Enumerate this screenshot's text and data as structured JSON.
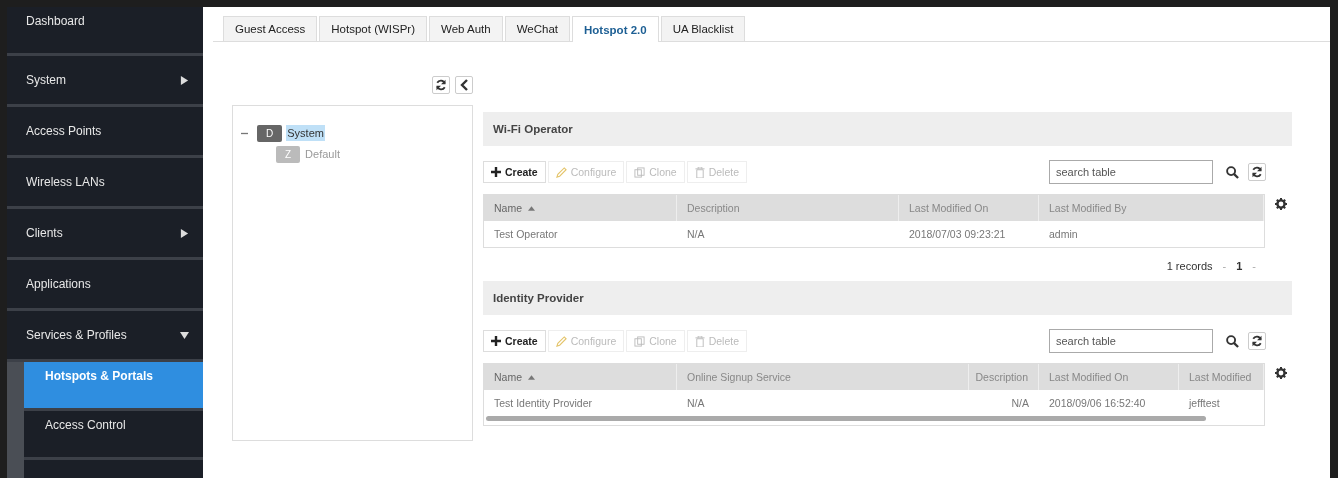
{
  "sidebar": {
    "items": [
      {
        "label": "Dashboard",
        "selected": false
      },
      {
        "label": "System",
        "selected": false,
        "expanded": false
      },
      {
        "label": "Access Points",
        "selected": false
      },
      {
        "label": "Wireless LANs",
        "selected": false
      },
      {
        "label": "Clients",
        "selected": false,
        "expanded": false
      },
      {
        "label": "Applications",
        "selected": false
      },
      {
        "label": "Services & Profiles",
        "selected": false,
        "expanded": true,
        "children": [
          {
            "label": "Hotspots & Portals",
            "selected": true
          },
          {
            "label": "Access Control",
            "selected": false
          }
        ]
      }
    ]
  },
  "tabs": [
    {
      "label": "Guest Access",
      "selected": false
    },
    {
      "label": "Hotspot (WISPr)",
      "selected": false
    },
    {
      "label": "Web Auth",
      "selected": false
    },
    {
      "label": "WeChat",
      "selected": false
    },
    {
      "label": "Hotspot 2.0",
      "selected": true
    },
    {
      "label": "UA Blacklist",
      "selected": false
    }
  ],
  "tree": [
    {
      "badge": "D",
      "label": "System",
      "selected": true,
      "expanded": true,
      "children": [
        {
          "badge": "Z",
          "label": "Default",
          "selected": false
        }
      ]
    }
  ],
  "sections": [
    {
      "title": "Wi-Fi Operator",
      "actions": [
        {
          "kind": "create",
          "label": "Create",
          "disabled": false
        },
        {
          "kind": "configure",
          "label": "Configure",
          "disabled": true
        },
        {
          "kind": "clone",
          "label": "Clone",
          "disabled": true
        },
        {
          "kind": "delete",
          "label": "Delete",
          "disabled": true
        }
      ],
      "search": {
        "placeholder": "search table"
      },
      "table": {
        "columns": [
          {
            "label": "Name",
            "sorted": true
          },
          {
            "label": "Description",
            "sorted": false
          },
          {
            "label": "Last Modified On",
            "sorted": false
          },
          {
            "label": "Last Modified By",
            "sorted": false
          }
        ],
        "rows": [
          [
            "Test Operator",
            "N/A",
            "2018/07/03 09:23:21",
            "admin"
          ]
        ],
        "scrollbar": false
      },
      "pagination": {
        "records": "1 records",
        "prev": "-",
        "page": "1",
        "next": "-"
      }
    },
    {
      "title": "Identity Provider",
      "actions": [
        {
          "kind": "create",
          "label": "Create",
          "disabled": false
        },
        {
          "kind": "configure",
          "label": "Configure",
          "disabled": true
        },
        {
          "kind": "clone",
          "label": "Clone",
          "disabled": true
        },
        {
          "kind": "delete",
          "label": "Delete",
          "disabled": true
        }
      ],
      "search": {
        "placeholder": "search table"
      },
      "table": {
        "columns": [
          {
            "label": "Name",
            "sorted": true
          },
          {
            "label": "Online Signup Service",
            "sorted": false
          },
          {
            "label": "Description",
            "sorted": false
          },
          {
            "label": "Last Modified On",
            "sorted": false
          },
          {
            "label": "Last Modified",
            "sorted": false
          }
        ],
        "rows": [
          [
            "Test Identity Provider",
            "N/A",
            "N/A",
            "2018/09/06 16:52:40",
            "jefftest"
          ]
        ],
        "scrollbar": true
      }
    }
  ]
}
